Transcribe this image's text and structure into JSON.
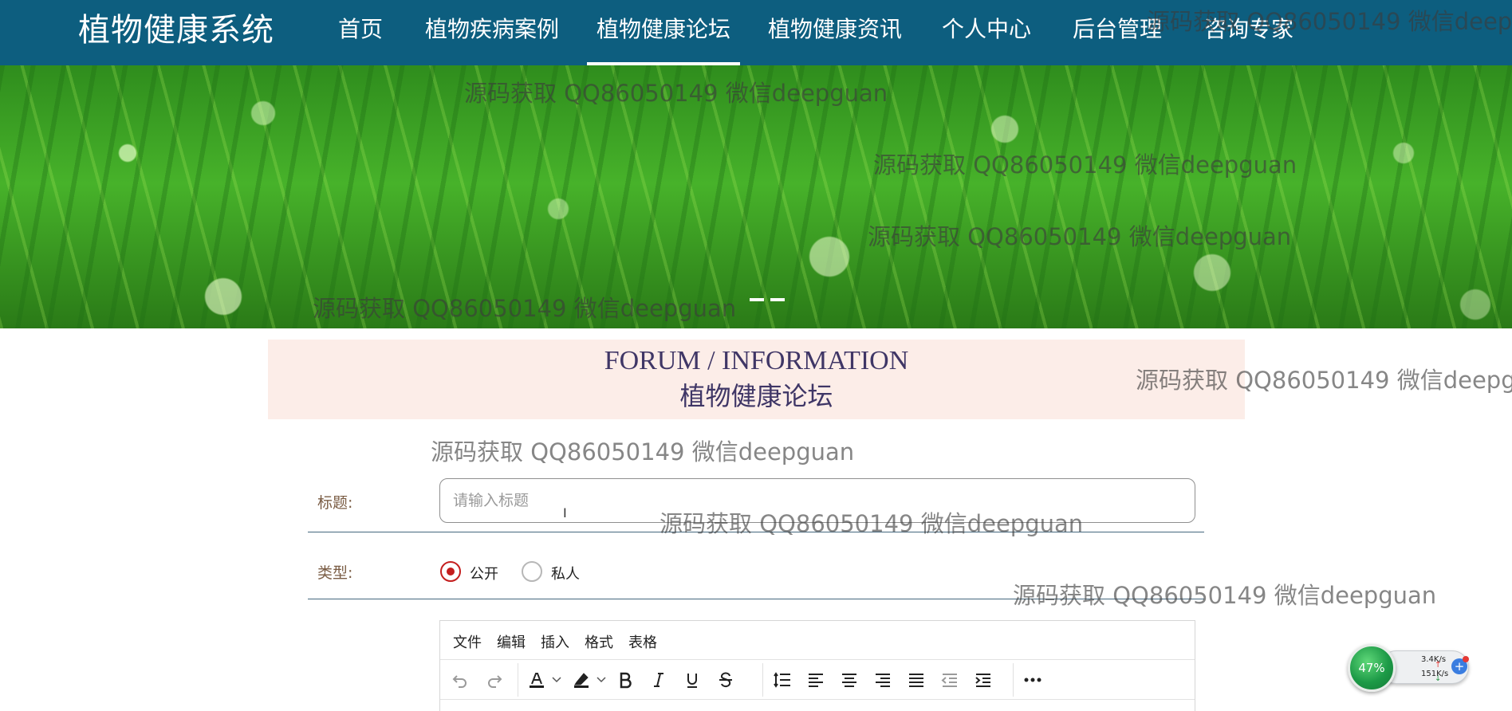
{
  "header": {
    "logo": "植物健康系统",
    "nav": [
      {
        "label": "首页",
        "active": false
      },
      {
        "label": "植物疾病案例",
        "active": false
      },
      {
        "label": "植物健康论坛",
        "active": true
      },
      {
        "label": "植物健康资讯",
        "active": false
      },
      {
        "label": "个人中心",
        "active": false
      },
      {
        "label": "后台管理",
        "active": false
      },
      {
        "label": "咨询专家",
        "active": false
      }
    ]
  },
  "banner": {
    "slides": 2,
    "current": 1
  },
  "section": {
    "title_en": "FORUM / INFORMATION",
    "title_zh": "植物健康论坛"
  },
  "form": {
    "title": {
      "label": "标题:",
      "value": "",
      "placeholder": "请输入标题"
    },
    "type": {
      "label": "类型:",
      "options": [
        {
          "label": "公开",
          "checked": true
        },
        {
          "label": "私人",
          "checked": false
        }
      ]
    }
  },
  "editor": {
    "menu": [
      "文件",
      "编辑",
      "插入",
      "格式",
      "表格"
    ],
    "toolbar": [
      "undo-icon",
      "redo-icon",
      "text-color-icon",
      "highlight-color-icon",
      "bold-icon",
      "italic-icon",
      "underline-icon",
      "strikethrough-icon",
      "line-height-icon",
      "align-left-icon",
      "align-center-icon",
      "align-right-icon",
      "align-justify-icon",
      "outdent-icon",
      "indent-icon",
      "more-icon"
    ],
    "text_color": "#1d1d1d",
    "highlight_color": "#1d1d1d"
  },
  "watermark_text": "源码获取 QQ86050149 微信deepguan",
  "net_widget": {
    "cpu": "47%",
    "upload": "3.4K/s",
    "download": "151K/s"
  },
  "colors": {
    "nav_bg": "#0d5e7f",
    "section_bg": "#fcede8",
    "section_text": "#3f3666",
    "label_text": "#7a5c44",
    "radio_accent": "#c41e1e"
  }
}
